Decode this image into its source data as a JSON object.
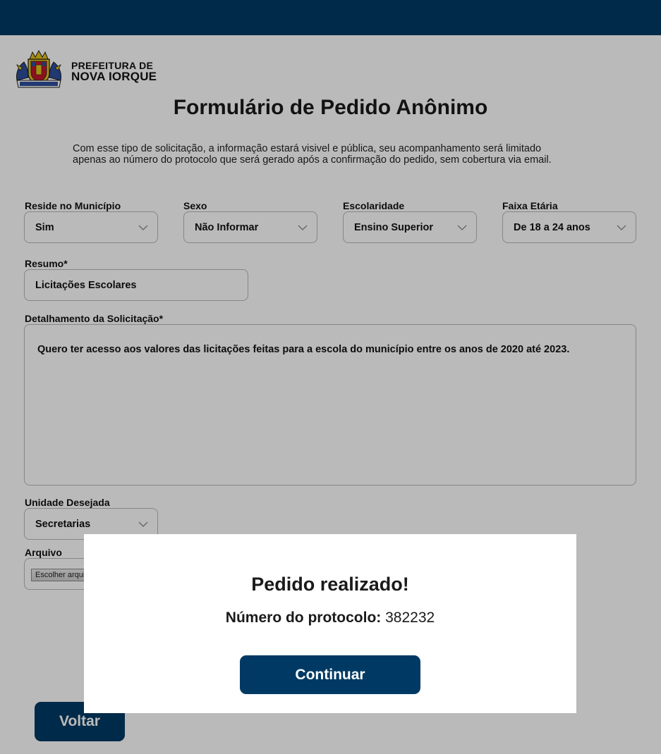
{
  "header": {
    "brand_line1": "PREFEITURA DE",
    "brand_line2": "NOVA IORQUE",
    "logo_label": "NOVA IORQUE"
  },
  "page": {
    "title": "Formulário de Pedido Anônimo",
    "intro_line1": "Com esse tipo de solicitação, a informação estará visivel e pública, seu acompanhamento será limitado",
    "intro_line2": "apenas ao número do protocolo que será gerado após a confirmação do pedido, sem cobertura via email."
  },
  "form": {
    "reside": {
      "label": "Reside no Município",
      "value": "Sim"
    },
    "sexo": {
      "label": "Sexo",
      "value": "Não Informar"
    },
    "escolaridade": {
      "label": "Escolaridade",
      "value": "Ensino Superior"
    },
    "faixa": {
      "label": "Faixa Etária",
      "value": "De 18 a 24 anos"
    },
    "resumo": {
      "label": "Resumo*",
      "value": "Licitações Escolares"
    },
    "detalhamento": {
      "label": "Detalhamento da Solicitação*",
      "value": "Quero ter acesso aos valores das licitações feitas para a escola do município entre os anos de 2020 até 2023."
    },
    "unidade": {
      "label": "Unidade Desejada",
      "value": "Secretarias"
    },
    "arquivo": {
      "label": "Arquivo",
      "button": "Escolher arquivo"
    },
    "back_button": "Voltar"
  },
  "modal": {
    "title": "Pedido realizado!",
    "protocol_label": "Número do protocolo:",
    "protocol_value": "382232",
    "continue_button": "Continuar"
  },
  "colors": {
    "primary": "#003a64",
    "overlay": "rgba(0,0,0,0.27)"
  },
  "icons": {
    "select_chevron": "chevron-down-icon",
    "logo": "city-crest-logo"
  }
}
